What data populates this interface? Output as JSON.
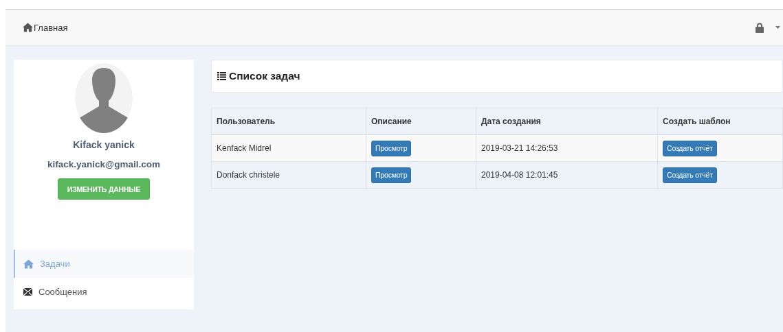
{
  "navbar": {
    "home_label": "Главная"
  },
  "profile": {
    "name": "Kifack yanick",
    "email": "kifack.yanick@gmail.com",
    "edit_button": "ИЗМЕНИТЬ ДАННЫЕ"
  },
  "sidebar": {
    "items": [
      {
        "label": "Задачи",
        "selected": true
      },
      {
        "label": "Сообщения",
        "selected": false
      }
    ]
  },
  "panel": {
    "title": "Список задач"
  },
  "table": {
    "columns": [
      "Пользователь",
      "Описание",
      "Дата создания",
      "Создать шаблон"
    ],
    "rows": [
      {
        "user": "Kenfack Midrel",
        "description_button": "Просмотр",
        "created": "2019-03-21 14:26:53",
        "template_button": "Создать отчёт"
      },
      {
        "user": "Donfack christele",
        "description_button": "Просмотр",
        "created": "2019-04-08 12:01:45",
        "template_button": "Создать отчёт"
      }
    ]
  }
}
